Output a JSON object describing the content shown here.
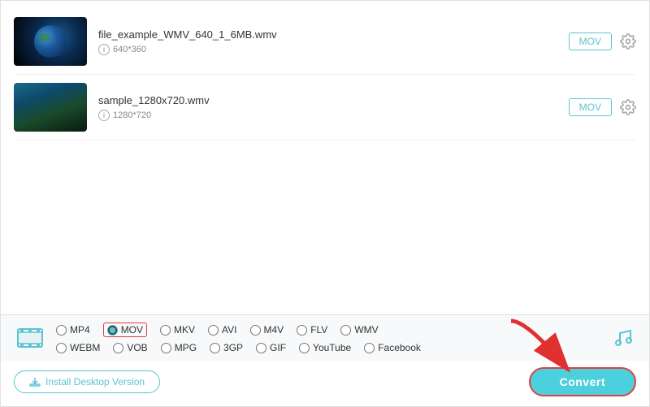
{
  "files": [
    {
      "name": "file_example_WMV_640_1_6MB.wmv",
      "resolution": "640*360",
      "format": "MOV",
      "thumb": "earth"
    },
    {
      "name": "sample_1280x720.wmv",
      "resolution": "1280*720",
      "format": "MOV",
      "thumb": "ocean"
    }
  ],
  "formats": {
    "row1": [
      "MP4",
      "MOV",
      "MKV",
      "AVI",
      "M4V",
      "FLV",
      "WMV"
    ],
    "row2": [
      "WEBM",
      "VOB",
      "MPG",
      "3GP",
      "GIF",
      "YouTube",
      "Facebook"
    ],
    "selected": "MOV"
  },
  "footer": {
    "install_label": "Install Desktop Version",
    "convert_label": "Convert"
  },
  "info_symbol": "i"
}
